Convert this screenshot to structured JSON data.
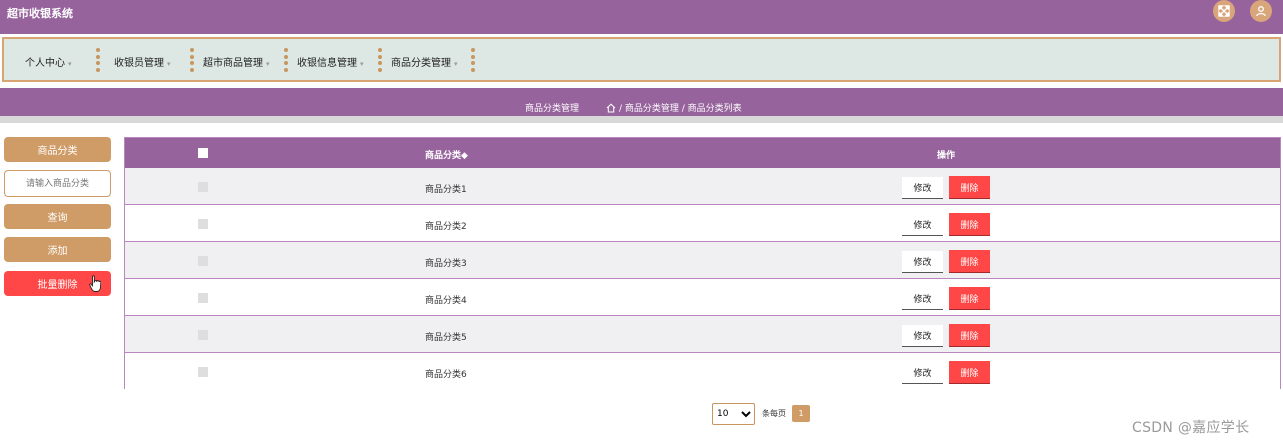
{
  "app": {
    "title": "超市收银系统"
  },
  "topbar": {
    "icons": [
      "expand-icon",
      "user-icon"
    ]
  },
  "nav": {
    "items": [
      {
        "label": "个人中心"
      },
      {
        "label": "收银员管理"
      },
      {
        "label": "超市商品管理"
      },
      {
        "label": "收银信息管理"
      },
      {
        "label": "商品分类管理"
      }
    ],
    "caret": "▾"
  },
  "breadcrumb": {
    "page_title": "商品分类管理",
    "path": "/ 商品分类管理 / 商品分类列表",
    "home_icon": "home-icon"
  },
  "sidebar": {
    "field_label": "商品分类",
    "search_placeholder": "请输入商品分类",
    "query_label": "查询",
    "add_label": "添加",
    "batch_delete_label": "批量删除"
  },
  "table": {
    "headers": {
      "name": "商品分类◆",
      "actions": "操作"
    },
    "rows": [
      {
        "name": "商品分类1",
        "edit": "修改",
        "delete": "删除"
      },
      {
        "name": "商品分类2",
        "edit": "修改",
        "delete": "删除"
      },
      {
        "name": "商品分类3",
        "edit": "修改",
        "delete": "删除"
      },
      {
        "name": "商品分类4",
        "edit": "修改",
        "delete": "删除"
      },
      {
        "name": "商品分类5",
        "edit": "修改",
        "delete": "删除"
      },
      {
        "name": "商品分类6",
        "edit": "修改",
        "delete": "删除"
      }
    ]
  },
  "pagination": {
    "page_size": "10",
    "page_size_label": "条每页",
    "current_page": "1"
  },
  "watermark": "CSDN @嘉应学长",
  "colors": {
    "primary": "#96639c",
    "accent": "#cf9c67",
    "danger": "#ff4747",
    "nav_bg": "#dde7e3"
  }
}
